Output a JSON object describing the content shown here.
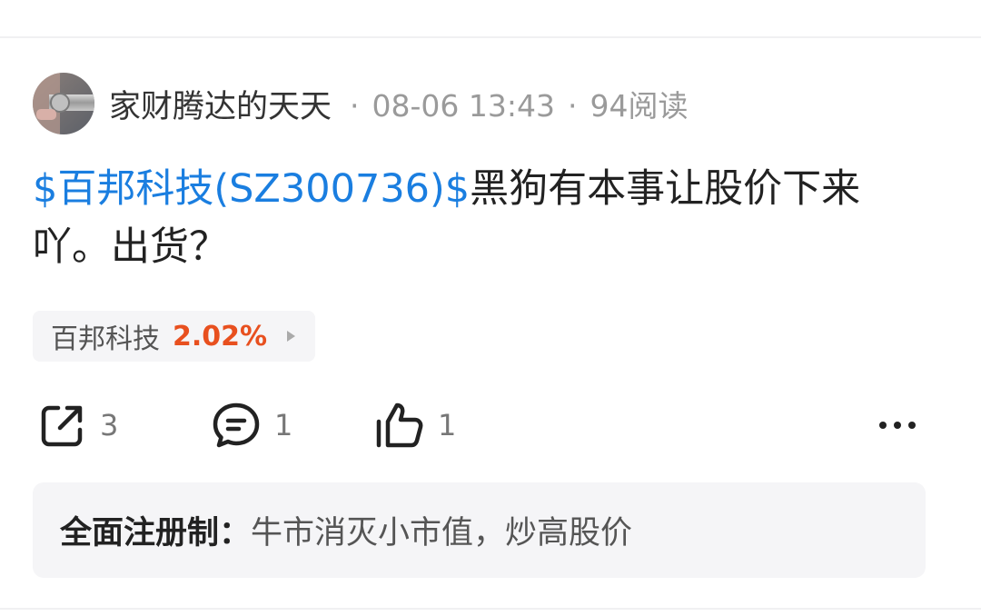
{
  "post": {
    "author": "家财腾达的天天",
    "time": "08-06 13:43",
    "reads": "94阅读",
    "separator": "·",
    "stock_link": "$百邦科技(SZ300736)$",
    "body": "黑狗有本事让股价下来吖。出货？"
  },
  "stock_chip": {
    "name": "百邦科技",
    "change": "2.02%",
    "change_color": "#e8501f"
  },
  "actions": {
    "share_count": "3",
    "comment_count": "1",
    "like_count": "1"
  },
  "promo": {
    "label": "全面注册制：",
    "text": "牛市消灭小市值，炒高股价"
  },
  "colors": {
    "link": "#1a7ee0",
    "muted": "#9a9a9a",
    "card_bg": "#f5f5f7"
  }
}
